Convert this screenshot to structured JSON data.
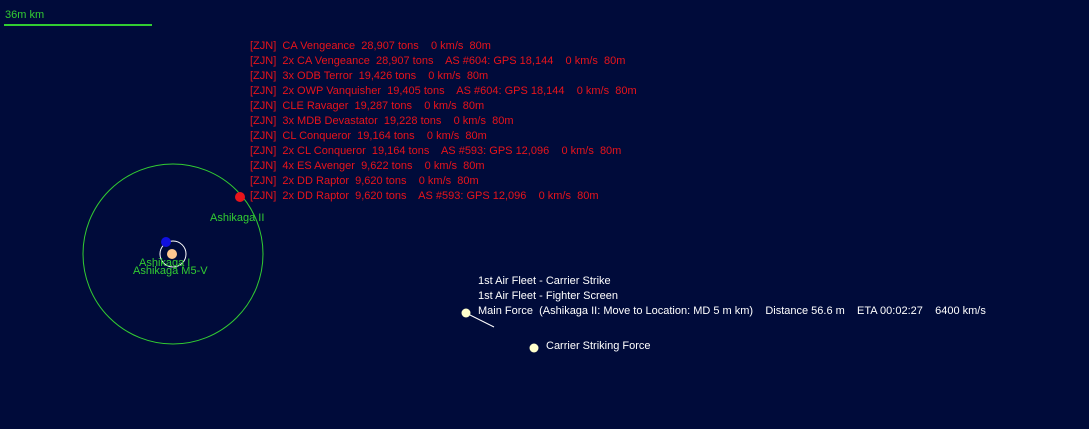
{
  "scale": {
    "label": "36m km"
  },
  "system_bodies": {
    "planet_label": "Ashikaga II",
    "moon_label": "Ashikaga I",
    "star_label": "Ashikaga M5-V"
  },
  "contacts": [
    "[ZJN]  CA Vengeance  28,907 tons    0 km/s  80m",
    "[ZJN]  2x CA Vengeance  28,907 tons    AS #604: GPS 18,144    0 km/s  80m",
    "[ZJN]  3x ODB Terror  19,426 tons    0 km/s  80m",
    "[ZJN]  2x OWP Vanquisher  19,405 tons    AS #604: GPS 18,144    0 km/s  80m",
    "[ZJN]  CLE Ravager  19,287 tons    0 km/s  80m",
    "[ZJN]  3x MDB Devastator  19,228 tons    0 km/s  80m",
    "[ZJN]  CL Conqueror  19,164 tons    0 km/s  80m",
    "[ZJN]  2x CL Conqueror  19,164 tons    AS #593: GPS 12,096    0 km/s  80m",
    "[ZJN]  4x ES Avenger  9,622 tons    0 km/s  80m",
    "[ZJN]  2x DD Raptor  9,620 tons    0 km/s  80m",
    "[ZJN]  2x DD Raptor  9,620 tons    AS #593: GPS 12,096    0 km/s  80m"
  ],
  "fleets": {
    "carrier_strike": "1st Air Fleet - Carrier Strike",
    "fighter_screen": "1st Air Fleet - Fighter Screen",
    "main_force": "Main Force  (Ashikaga II: Move to Location: MD 5 m km)    Distance 56.6 m    ETA 00:02:27    6400 km/s",
    "carrier_striking_force": "Carrier Striking Force"
  },
  "colors": {
    "background": "#000b3a",
    "friendly_label": "#32cd32",
    "hostile": "#e8141b",
    "fleet_marker": "#ffffcc",
    "moon": "#1010e0",
    "star": "#ffc890"
  }
}
